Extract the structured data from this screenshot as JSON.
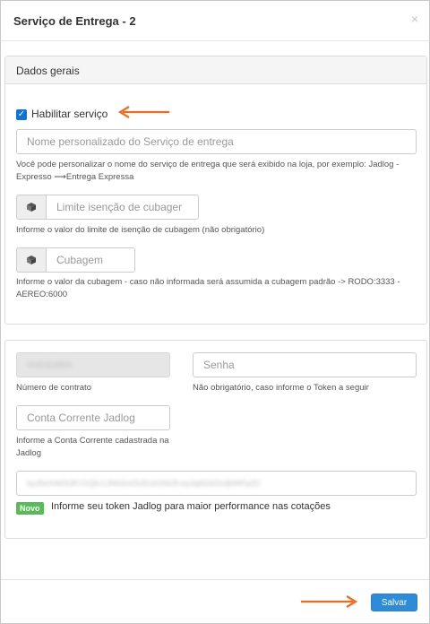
{
  "modal": {
    "title": "Serviço de Entrega - 2",
    "close_symbol": "×"
  },
  "section_general": {
    "heading": "Dados gerais",
    "enable_checkbox": {
      "label": "Habilitar serviço",
      "checked": true
    },
    "custom_name": {
      "placeholder": "Nome personalizado do Serviço de entrega",
      "help": "Você pode personalizar o nome do serviço de entrega que será exibido na loja, por exemplo: Jadlog - Expresso ⟶Entrega Expressa"
    },
    "cubage_exemption": {
      "icon": "cube-icon",
      "placeholder": "Limite isenção de cubager",
      "help": "Informe o valor do limite de isenção de cubagem (não obrigatório)"
    },
    "cubage": {
      "icon": "cube-icon",
      "placeholder": "Cubagem",
      "help": "Informe o valor da cubagem - caso não informada será assumida a cubagem padrão -> RODO:3333 - AEREO:6000"
    }
  },
  "section_credentials": {
    "contract_number": {
      "value": "4041924809",
      "help": "Número de contrato"
    },
    "password": {
      "placeholder": "Senha",
      "help": "Não obrigatório, caso informe o Token a seguir"
    },
    "checking_account": {
      "placeholder": "Conta Corrente Jadlog",
      "help": "Informe a Conta Corrente cadastrada na Jadlog"
    },
    "token": {
      "value": "eyJ0eXAiOiJKV1QiLCJhbGciOiJIUzI1NiJ9.eyJqdGkiOiJjbWFpZC",
      "badge": "Novo",
      "help": "Informe seu token Jadlog para maior performance nas cotações"
    }
  },
  "footer": {
    "save_label": "Salvar"
  },
  "colors": {
    "arrow": "#f26b1d",
    "primary": "#2e8bd7",
    "badge": "#5cb85c",
    "checkbox": "#0f73d8"
  }
}
